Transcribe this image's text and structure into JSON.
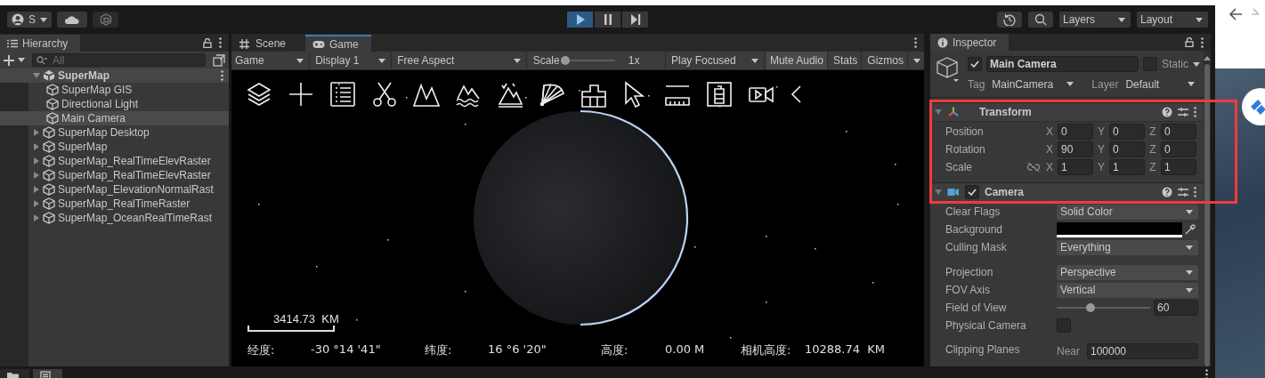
{
  "toolbar": {
    "account": "S",
    "play_controls": [
      {
        "kind": "play",
        "selected": true
      },
      {
        "kind": "pause",
        "selected": false
      },
      {
        "kind": "step",
        "selected": false
      }
    ],
    "layers": "Layers",
    "layout": "Layout"
  },
  "hierarchy": {
    "title": "Hierarchy",
    "search": {
      "placeholder": "All"
    },
    "tree": [
      {
        "label": "SuperMap",
        "kind": "scene",
        "expanded": true,
        "children": [
          {
            "label": "SuperMap GIS",
            "kind": "object",
            "selected": false
          },
          {
            "label": "Directional Light",
            "kind": "object",
            "selected": false
          },
          {
            "label": "Main Camera",
            "kind": "object",
            "selected": true
          },
          {
            "label": "SuperMap Desktop",
            "kind": "object",
            "selected": false,
            "expanded": false
          },
          {
            "label": "SuperMap",
            "kind": "object",
            "selected": false,
            "expanded": false
          },
          {
            "label": "SuperMap_RealTimeElevRaster",
            "kind": "object",
            "selected": false,
            "expanded": false
          },
          {
            "label": "SuperMap_RealTimeElevRaster",
            "kind": "object",
            "selected": false,
            "expanded": false
          },
          {
            "label": "SuperMap_ElevationNormalRast",
            "kind": "object",
            "selected": false,
            "expanded": false
          },
          {
            "label": "SuperMap_RealTimeRaster",
            "kind": "object",
            "selected": false,
            "expanded": false
          },
          {
            "label": "SuperMap_OceanRealTimeRast",
            "kind": "object",
            "selected": false,
            "expanded": false
          }
        ]
      }
    ]
  },
  "game_view": {
    "tabs": [
      {
        "label": "Scene",
        "kind": "scene",
        "selected": false
      },
      {
        "label": "Game",
        "kind": "game",
        "selected": true
      }
    ],
    "toolbar": {
      "mode": "Game",
      "display": "Display 1",
      "aspect": "Free Aspect",
      "scale": {
        "label": "Scale",
        "level": 0,
        "reading": "1x"
      },
      "play_mode": "Play Focused",
      "toggles": [
        {
          "label": "Mute Audio",
          "on": true,
          "dropdown": false
        },
        {
          "label": "Stats",
          "on": false,
          "dropdown": false
        },
        {
          "label": "Gizmos",
          "on": false,
          "dropdown": true
        }
      ]
    },
    "scale_bar": "3414.73  KM",
    "status": [
      {
        "label": "经度:",
        "value": "-30 °14 '41\""
      },
      {
        "label": "纬度:",
        "value": "16 °6 '20\""
      },
      {
        "label": "高度:",
        "value": "0.00 M"
      },
      {
        "label": "相机高度:",
        "value": "10288.74  KM"
      }
    ]
  },
  "inspector": {
    "title": "Inspector",
    "object": {
      "active": true,
      "name": "Main Camera",
      "static": false,
      "static_label": "Static",
      "tag_label": "Tag",
      "tag": "MainCamera",
      "layer_label": "Layer",
      "layer": "Default"
    },
    "components": [
      {
        "kind": "transform",
        "title": "Transform",
        "rows": [
          {
            "label": "Position",
            "link_icon": false,
            "axes": [
              {
                "axis": "X",
                "value": "0"
              },
              {
                "axis": "Y",
                "value": "0"
              },
              {
                "axis": "Z",
                "value": "0"
              }
            ]
          },
          {
            "label": "Rotation",
            "link_icon": false,
            "axes": [
              {
                "axis": "X",
                "value": "90"
              },
              {
                "axis": "Y",
                "value": "0"
              },
              {
                "axis": "Z",
                "value": "0"
              }
            ]
          },
          {
            "label": "Scale",
            "link_icon": true,
            "axes": [
              {
                "axis": "X",
                "value": "1"
              },
              {
                "axis": "Y",
                "value": "1"
              },
              {
                "axis": "Z",
                "value": "1"
              }
            ]
          }
        ]
      },
      {
        "kind": "camera",
        "title": "Camera",
        "enabled": true,
        "properties": [
          {
            "kind": "dropdown",
            "label": "Clear Flags",
            "value": "Solid Color"
          },
          {
            "kind": "color",
            "label": "Background",
            "color": "#000000"
          },
          {
            "kind": "dropdown",
            "label": "Culling Mask",
            "value": "Everything"
          },
          {
            "kind": "spacer"
          },
          {
            "kind": "dropdown",
            "label": "Projection",
            "value": "Perspective"
          },
          {
            "kind": "dropdown",
            "label": "FOV Axis",
            "value": "Vertical"
          },
          {
            "kind": "slider",
            "label": "Field of View",
            "level": 0.36,
            "value": "60"
          },
          {
            "kind": "checkbox",
            "label": "Physical Camera",
            "checked": false
          },
          {
            "kind": "spacer"
          },
          {
            "kind": "pair",
            "label": "Clipping Planes",
            "fields": [
              {
                "label": "Near",
                "value": "100000"
              }
            ]
          }
        ]
      }
    ]
  },
  "bottom_tabs": [
    {
      "kind": "folder",
      "selected": false
    },
    {
      "kind": "console",
      "selected": true
    }
  ]
}
